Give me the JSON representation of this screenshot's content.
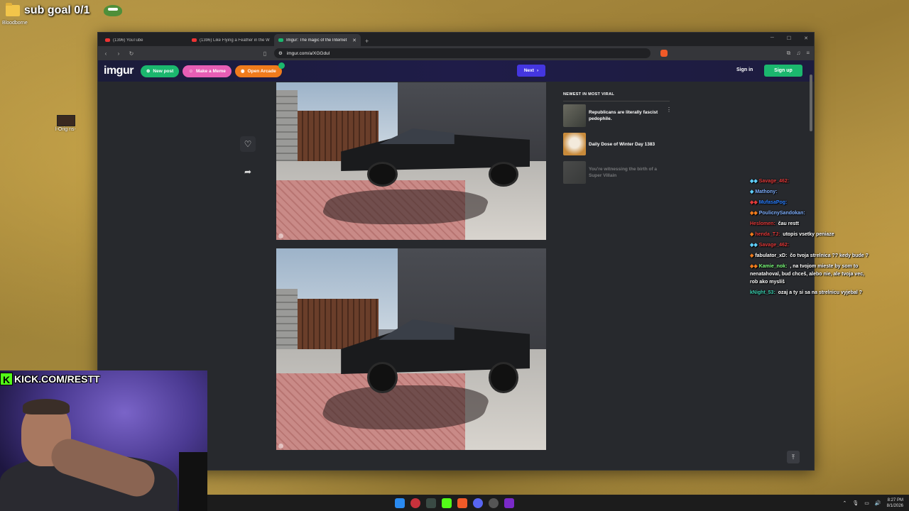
{
  "overlay": {
    "subgoal": "sub goal 0/1",
    "desktop_icon_1": "Bloodborne",
    "desktop_icon_2": "l-Orig ns-"
  },
  "browser": {
    "tabs": [
      {
        "title": "(1396) YouTube",
        "favicon": "youtube-icon"
      },
      {
        "title": "(1396) Like Flying a Feather in the W",
        "favicon": "youtube-icon"
      },
      {
        "title": "Imgur: The magic of the Internet",
        "favicon": "imgur-icon",
        "active": true
      }
    ],
    "url": "imgur.com/a/XGGdul"
  },
  "imgur": {
    "logo": "imgur",
    "new_post": "New post",
    "make_meme": "Make a Meme",
    "open_arcade": "Open Arcade",
    "next": "Next",
    "sign_in": "Sign in",
    "sign_up": "Sign up",
    "viral_heading": "NEWEST IN MOST VIRAL",
    "viral_items": [
      {
        "title": "Republicans are literally fascist pedophile."
      },
      {
        "title": "Daily Dose of Winter Day 1383"
      },
      {
        "title": "You're witnessing the birth of a Super Villain"
      }
    ]
  },
  "chat": [
    {
      "user": "Savage_462:",
      "msg": "",
      "color": "#e23a3a"
    },
    {
      "user": "Mathony:",
      "msg": "",
      "color": "#7fb0ff"
    },
    {
      "user": "MufasaPog:",
      "msg": "",
      "color": "#2a7fff"
    },
    {
      "user": "PoulicnySandokan:",
      "msg": "",
      "color": "#7fb0ff"
    },
    {
      "user": "Heslomen:",
      "msg": "čau restt",
      "color": "#e23a3a"
    },
    {
      "user": "henda_TJ:",
      "msg": "utopis vsetky peniaze",
      "color": "#e23a3a"
    },
    {
      "user": "Savage_462:",
      "msg": "",
      "color": "#e23a3a"
    },
    {
      "user": "fabulator_xD:",
      "msg": "čo tvoja strelnica ?? kedy bude ?",
      "color": "#ffffff"
    },
    {
      "user": "Kamie_nok:",
      "msg": ", na tvojom mieste by som to nenatahoval, bud chceš, alebo nie, ale tvoja vec, rob ako myslíš",
      "color": "#7cff7c"
    },
    {
      "user": "kNight_53:",
      "msg": "ozaj a ty si sa na strelnicu vyjebal ?",
      "color": "#3ad0b0"
    }
  ],
  "webcam": {
    "banner": "KICK.COM/RESTT"
  },
  "taskbar": {
    "time": "8:27 PM",
    "date": "8/1/2026"
  }
}
